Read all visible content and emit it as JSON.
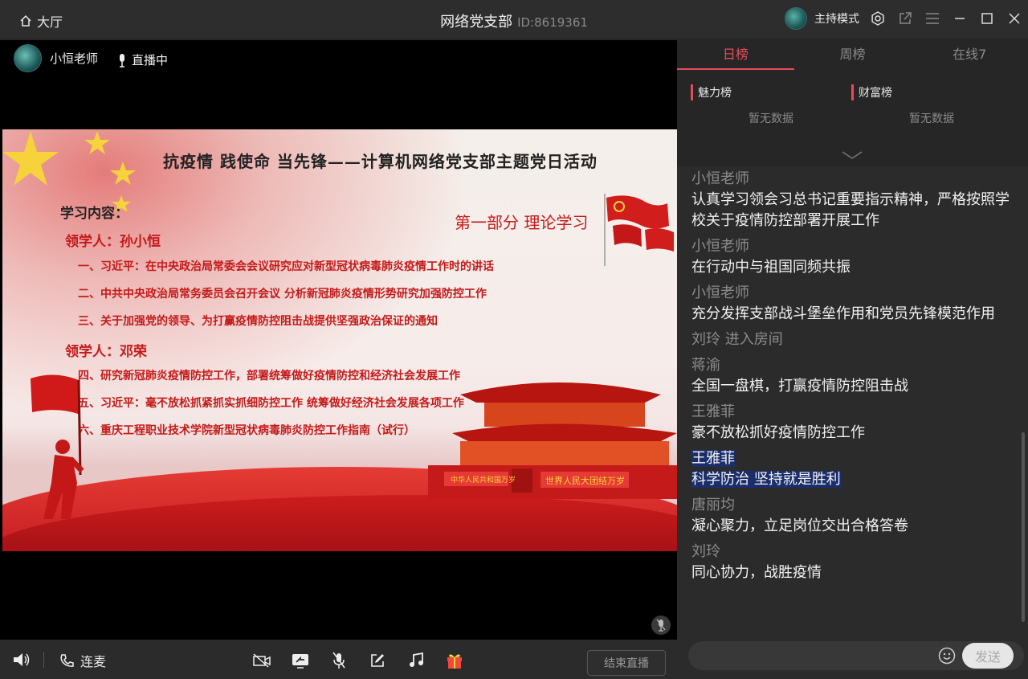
{
  "titlebar": {
    "home_label": "大厅",
    "title": "网络党支部",
    "room_id": "ID:8619361",
    "host_mode_label": "主持模式"
  },
  "video": {
    "presenter_name": "小恒老师",
    "live_status": "直播中"
  },
  "slide": {
    "title": "抗疫情 践使命 当先锋——计算机网络党支部主题党日活动",
    "part_title": "第一部分  理论学习",
    "study_heading": "学习内容：",
    "leader1": "领学人：孙小恒",
    "leader2": "领学人：邓荣",
    "items": [
      "一、习近平：在中央政治局常委会会议研究应对新型冠状病毒肺炎疫情工作时的讲话",
      "二、中共中央政治局常务委员会召开会议 分析新冠肺炎疫情形势研究加强防控工作",
      "三、关于加强党的领导、为打赢疫情防控阻击战提供坚强政治保证的通知",
      "四、研究新冠肺炎疫情防控工作，部署统筹做好疫情防控和经济社会发展工作",
      "五、习近平：毫不放松抓紧抓实抓细防控工作 统筹做好经济社会发展各项工作",
      "六、重庆工程职业技术学院新型冠状病毒肺炎防控工作指南（试行）"
    ],
    "gate_banner_left": "中华人民共和国万岁",
    "gate_banner_right": "世界人民大团结万岁"
  },
  "bottom_bar": {
    "lianmai_label": "连麦",
    "end_live_label": "结束直播"
  },
  "rank": {
    "tabs": [
      "日榜",
      "周榜",
      "在线7"
    ],
    "charm_label": "魅力榜",
    "wealth_label": "财富榜",
    "charm_empty": "暂无数据",
    "wealth_empty": "暂无数据"
  },
  "chat": {
    "m1_user": "小恒老师",
    "m1_text": "认真学习领会习总书记重要指示精神，严格按照学校关于疫情防控部署开展工作",
    "m2_user": "小恒老师",
    "m2_text": "在行动中与祖国同频共振",
    "m3_user": "小恒老师",
    "m3_text": "充分发挥支部战斗堡垒作用和党员先锋模范作用",
    "event1": "刘玲 进入房间",
    "m4_user": "蒋渝",
    "m4_text": "全国一盘棋，打赢疫情防控阻击战",
    "m5_user": "王雅菲",
    "m5_text": "豪不放松抓好疫情防控工作",
    "m6_user": "王雅菲",
    "m6_text": "科学防治 坚持就是胜利",
    "m7_user": "唐丽均",
    "m7_text": "凝心聚力，立足岗位交出合格答卷",
    "m8_user": "刘玲",
    "m8_text": "同心协力，战胜疫情"
  },
  "input": {
    "send_label": "发送"
  },
  "colors": {
    "accent": "#e84c5a",
    "highlight": "#1b2e6b",
    "slide_red": "#c41a1a"
  }
}
